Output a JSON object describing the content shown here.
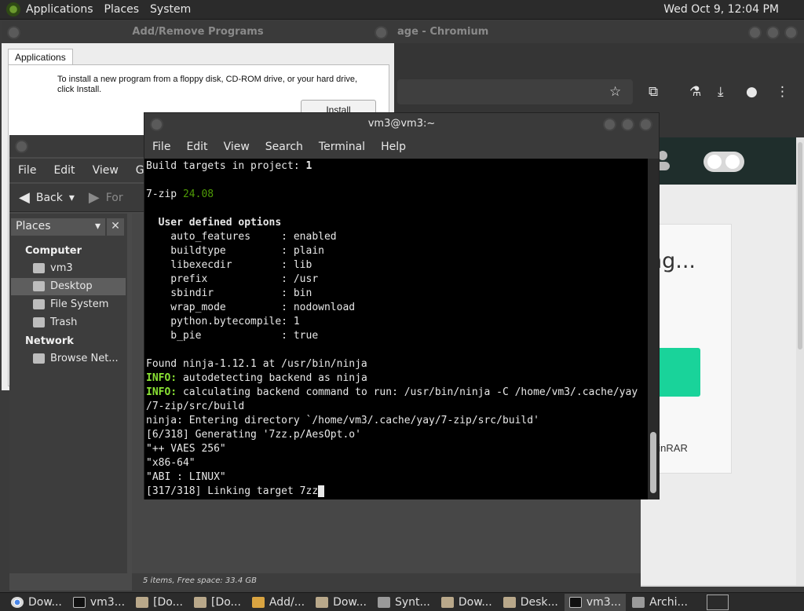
{
  "top_panel": {
    "menus": [
      "Applications",
      "Places",
      "System"
    ],
    "clock": "Wed Oct  9, 12:04 PM"
  },
  "chromium": {
    "title": "age - Chromium",
    "page_heading": "ng...",
    "winrar_label": "WinRAR"
  },
  "add_remove": {
    "title": "Add/Remove Programs",
    "tab": "Applications",
    "info": "To install a new program from a floppy disk, CD-ROM drive, or your hard drive, click Install.",
    "install_button": "Install"
  },
  "file_manager": {
    "menus": [
      "File",
      "Edit",
      "View",
      "Go"
    ],
    "back_label": "Back",
    "forward_label": "For",
    "places_header": "Places",
    "sections": {
      "computer": "Computer",
      "network": "Network"
    },
    "items": {
      "vm3": "vm3",
      "desktop": "Desktop",
      "filesystem": "File System",
      "trash": "Trash",
      "browse_network": "Browse Net..."
    },
    "status": "5 items, Free space: 33.4 GB"
  },
  "terminal": {
    "title": "vm3@vm3:~",
    "menus": [
      "File",
      "Edit",
      "View",
      "Search",
      "Terminal",
      "Help"
    ],
    "lines": {
      "l1_a": "Build targets in project: ",
      "l1_b": "1",
      "l2_a": "7-zip ",
      "l2_b": "24.08",
      "l3": "  User defined options",
      "opt1": "    auto_features     : enabled",
      "opt2": "    buildtype         : plain",
      "opt3": "    libexecdir        : lib",
      "opt4": "    prefix            : /usr",
      "opt5": "    sbindir           : bin",
      "opt6": "    wrap_mode         : nodownload",
      "opt7": "    python.bytecompile: 1",
      "opt8": "    b_pie             : true",
      "found": "Found ninja-1.12.1 at /usr/bin/ninja",
      "info_tag": "INFO:",
      "info1": " autodetecting backend as ninja",
      "info2": " calculating backend command to run: /usr/bin/ninja -C /home/vm3/.cache/yay",
      "info2b": "/7-zip/src/build",
      "ninja": "ninja: Entering directory `/home/vm3/.cache/yay/7-zip/src/build'",
      "gen": "[6/318] Generating '7zz.p/AesOpt.o'",
      "q1": "\"++ VAES 256\"",
      "q2": "\"x86-64\"",
      "q3": "\"ABI : LINUX\"",
      "link": "[317/318] Linking target 7zz"
    }
  },
  "taskbar": {
    "tasks": [
      "Dow...",
      "vm3...",
      "[Do...",
      "[Do...",
      "Add/...",
      "Dow...",
      "Synt...",
      "Dow...",
      "Desk...",
      "vm3...",
      "Archi..."
    ]
  }
}
